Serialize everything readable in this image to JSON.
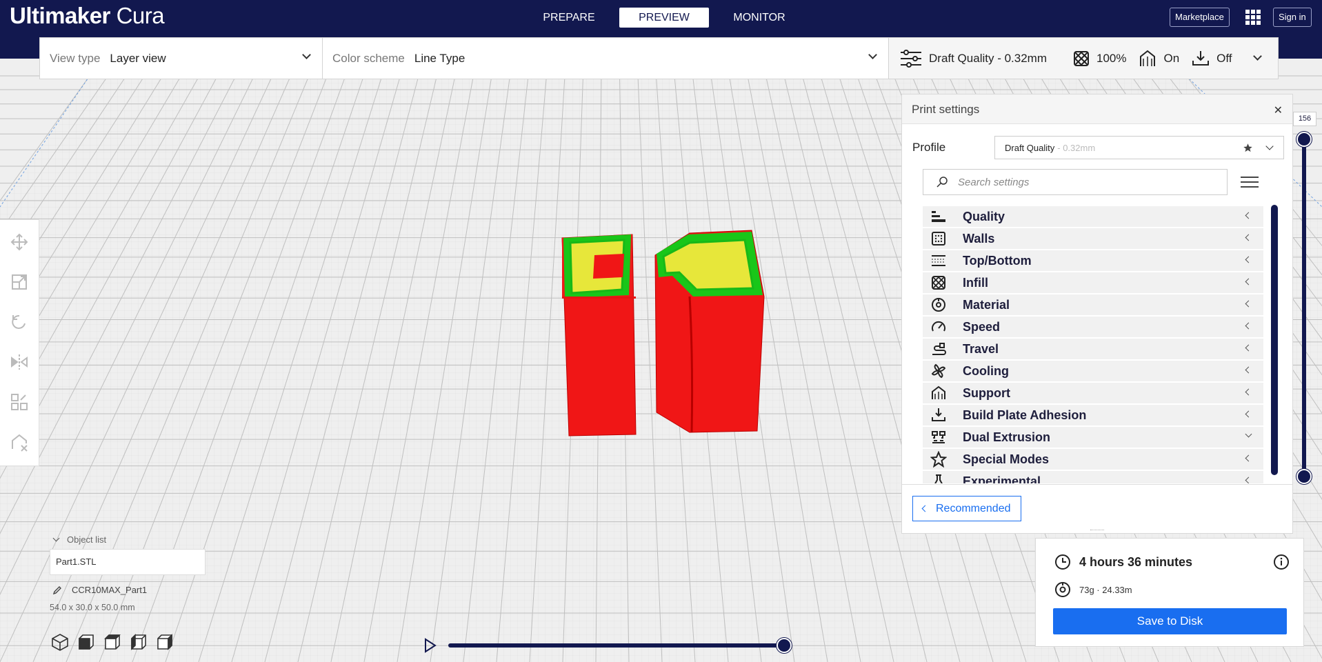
{
  "app": {
    "logo_bold": "Ultimaker",
    "logo_light": "Cura"
  },
  "header": {
    "stages": [
      "PREPARE",
      "PREVIEW",
      "MONITOR"
    ],
    "active_stage": "PREVIEW",
    "marketplace_label": "Marketplace",
    "signin_label": "Sign in"
  },
  "toolbar": {
    "view_type_label": "View type",
    "view_type_value": "Layer view",
    "color_scheme_label": "Color scheme",
    "color_scheme_value": "Line Type",
    "quality": "Draft Quality - 0.32mm",
    "infill": "100%",
    "support": "On",
    "adhesion": "Off"
  },
  "layer_slider": {
    "current_layer": "156"
  },
  "print_settings": {
    "title": "Print settings",
    "profile_label": "Profile",
    "profile_name": "Draft Quality",
    "profile_sub": "- 0.32mm",
    "search_placeholder": "Search settings",
    "categories": [
      {
        "label": "Quality",
        "icon": "quality-icon",
        "expanded": false
      },
      {
        "label": "Walls",
        "icon": "walls-icon",
        "expanded": false
      },
      {
        "label": "Top/Bottom",
        "icon": "top-bottom-icon",
        "expanded": false
      },
      {
        "label": "Infill",
        "icon": "infill-icon",
        "expanded": false
      },
      {
        "label": "Material",
        "icon": "material-icon",
        "expanded": false
      },
      {
        "label": "Speed",
        "icon": "speed-icon",
        "expanded": false
      },
      {
        "label": "Travel",
        "icon": "travel-icon",
        "expanded": false
      },
      {
        "label": "Cooling",
        "icon": "cooling-icon",
        "expanded": false
      },
      {
        "label": "Support",
        "icon": "support-icon",
        "expanded": false
      },
      {
        "label": "Build Plate Adhesion",
        "icon": "adhesion-icon",
        "expanded": false
      },
      {
        "label": "Dual Extrusion",
        "icon": "dual-extrusion-icon",
        "expanded": true
      },
      {
        "label": "Special Modes",
        "icon": "special-modes-icon",
        "expanded": false
      },
      {
        "label": "Experimental",
        "icon": "experimental-icon",
        "expanded": false
      }
    ],
    "recommended_label": "Recommended"
  },
  "object_list": {
    "title": "Object list",
    "selected_file": "Part1.STL",
    "object_name": "CCR10MAX_Part1",
    "dimensions": "54.0 x 30.0 x 50.0 mm"
  },
  "output": {
    "print_time": "4 hours 36 minutes",
    "material": "73g · 24.33m",
    "save_label": "Save to Disk"
  },
  "colors": {
    "header_bg": "#12184f",
    "accent": "#196ef0",
    "wall_outer": "#ff1a1a",
    "wall_inner": "#22dd22",
    "infill": "#e8e83a"
  }
}
